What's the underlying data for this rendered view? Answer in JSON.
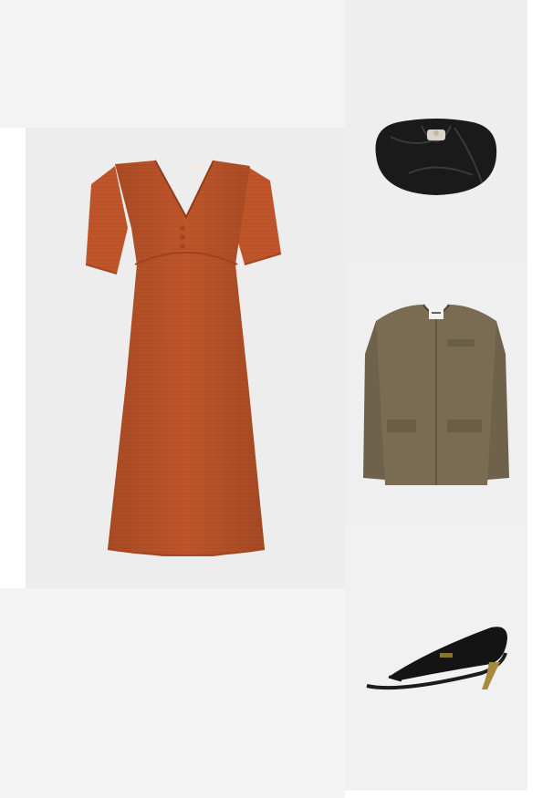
{
  "outfit": {
    "items": [
      {
        "id": "dress",
        "kind": "orange short-sleeve v-neck midi dress",
        "color": "#c0562a"
      },
      {
        "id": "bag",
        "kind": "black gathered leather clutch",
        "color": "#1a1a1a"
      },
      {
        "id": "jacket",
        "kind": "olive collarless blazer",
        "color": "#7a6c53"
      },
      {
        "id": "shoe",
        "kind": "black thong kitten-heel sandal",
        "color": "#141414"
      }
    ]
  },
  "colors": {
    "background": "#ffffff",
    "panel_light": "#f3f3f3",
    "panel_mid": "#ededed"
  }
}
